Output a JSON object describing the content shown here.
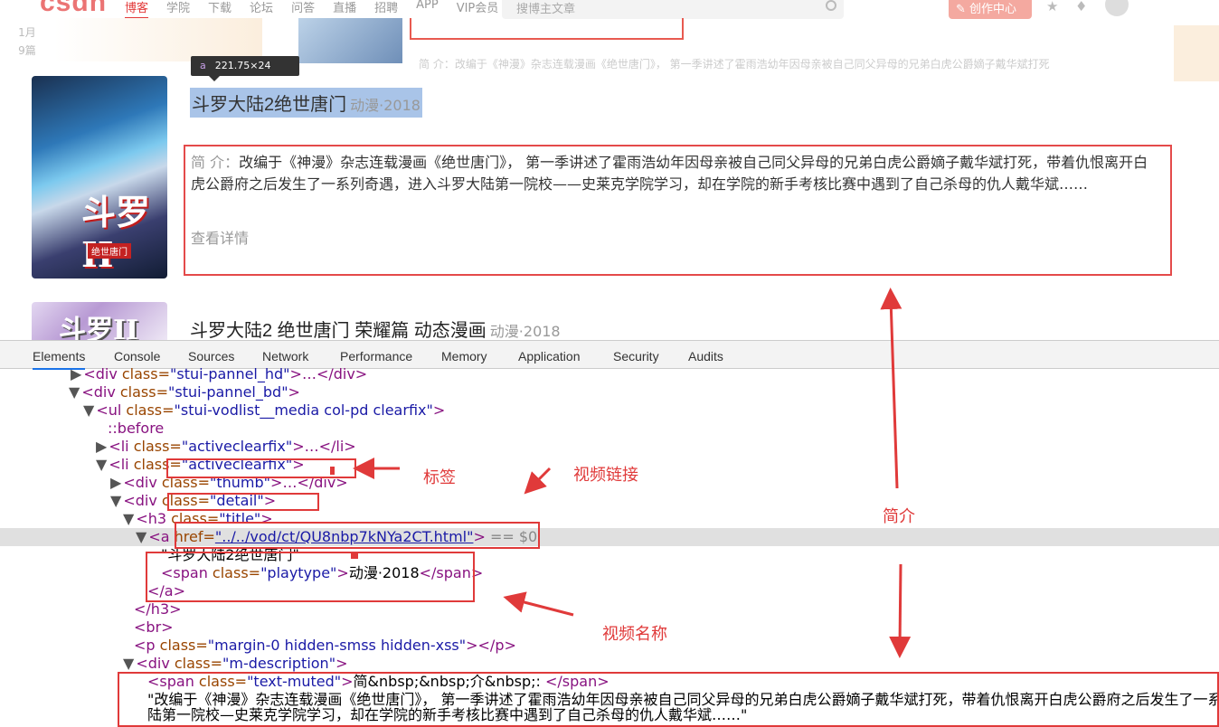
{
  "topbar": {
    "logo": "csdn",
    "nav": [
      "博客",
      "学院",
      "下载",
      "论坛",
      "问答",
      "直播",
      "招聘",
      "APP",
      "VIP会员"
    ],
    "search_placeholder": "搜博主文章",
    "creator_button": "创作中心"
  },
  "strip": {
    "date_line1": "1月",
    "date_line2": "9篇",
    "ghost_text": "简  介：改编于《神漫》杂志连载漫画《绝世唐门》，  第一季讲述了霍雨浩幼年因母亲被自己同父异母的兄弟白虎公爵嫡子戴华斌打死"
  },
  "tooltip": {
    "tag": "a",
    "size": "221.75×24"
  },
  "item1": {
    "poster_title": "斗罗II",
    "poster_sub": "绝世唐门",
    "name": "斗罗大陆2绝世唐门",
    "playtype": "动漫·2018",
    "desc_label": "简  介：",
    "desc_text": "改编于《神漫》杂志连载漫画《绝世唐门》，  第一季讲述了霍雨浩幼年因母亲被自己同父异母的兄弟白虎公爵嫡子戴华斌打死，带着仇恨离开白虎公爵府之后发生了一系列奇遇，进入斗罗大陆第一院校——史莱克学院学习，却在学院的新手考核比赛中遇到了自己杀母的仇人戴华斌……",
    "more": "查看详情"
  },
  "item2": {
    "poster_title": "斗罗II",
    "name": "斗罗大陆2 绝世唐门 荣耀篇 动态漫画",
    "playtype": "动漫·2018"
  },
  "devtools": {
    "tabs": [
      "Elements",
      "Console",
      "Sources",
      "Network",
      "Performance",
      "Memory",
      "Application",
      "Security",
      "Audits"
    ],
    "lines": {
      "l0_tag": "<div",
      "l0_attr": " class=",
      "l0_val": "\"stui-pannel_hd\"",
      "l0_tail": ">…</div>",
      "l1_tag": "<div",
      "l1_attr": " class=",
      "l1_val": "\"stui-pannel_bd\"",
      "l1_tail": ">",
      "l2_tag": "<ul",
      "l2_attr": " class=",
      "l2_val": "\"stui-vodlist__media col-pd clearfix\"",
      "l2_tail": ">",
      "l3": "::before",
      "l4_tag": "<li",
      "l4_attr": " class=",
      "l4_val": "\"activeclearfix\"",
      "l4_tail": ">…</li>",
      "l5_tag": "<li",
      "l5_attr": " class=",
      "l5_val": "\"activeclearfix\"",
      "l5_tail": ">",
      "l6_tag": "<div",
      "l6_attr": " class=",
      "l6_val": "\"thumb\"",
      "l6_tail": ">…</div>",
      "l7_tag": "<div",
      "l7_attr": " class=",
      "l7_val": "\"detail\"",
      "l7_tail": ">",
      "l8_tag": "<h3",
      "l8_attr": " class=",
      "l8_val": "\"title\"",
      "l8_tail": ">",
      "l9_tag": "<a",
      "l9_attr": " href=",
      "l9_val": "\"../../vod/ct/QU8nbp7kNYa2CT.html\"",
      "l9_tail": ">",
      "l9_eq": " == $0",
      "l10": "\"斗罗大陆2绝世唐门\"",
      "l11_tag": "<span",
      "l11_attr": " class=",
      "l11_val": "\"playtype\"",
      "l11_text": "动漫·2018",
      "l11_close": "</span>",
      "l12": "</a>",
      "l13": "</h3>",
      "l14": "<br>",
      "l15_tag": "<p",
      "l15_attr": " class=",
      "l15_val": "\"margin-0 hidden-smss hidden-xss\"",
      "l15_tail": "></p>",
      "l16_tag": "<div",
      "l16_attr": " class=",
      "l16_val": "\"m-description\"",
      "l16_tail": ">",
      "l17_tag": "<span",
      "l17_attr": " class=",
      "l17_val": "\"text-muted\"",
      "l17_text": "简&nbsp;&nbsp;介&nbsp;: ",
      "l17_close": "</span>",
      "l18": "\"改编于《神漫》杂志连载漫画《绝世唐门》， 第一季讲述了霍雨浩幼年因母亲被自己同父异母的兄弟白虎公爵嫡子戴华斌打死，带着仇恨离开白虎公爵府之后发生了一系列奇遇，",
      "l19": "陆第一院校—史莱克学院学习，却在学院的新手考核比赛中遇到了自己杀母的仇人戴华斌……\""
    }
  },
  "annotations": {
    "tag_label": "标签",
    "link_label": "视频链接",
    "name_label": "视频名称",
    "desc_label": "简介"
  },
  "colors": {
    "annotation": "#e03a3a",
    "brand": "#e33a3a"
  }
}
